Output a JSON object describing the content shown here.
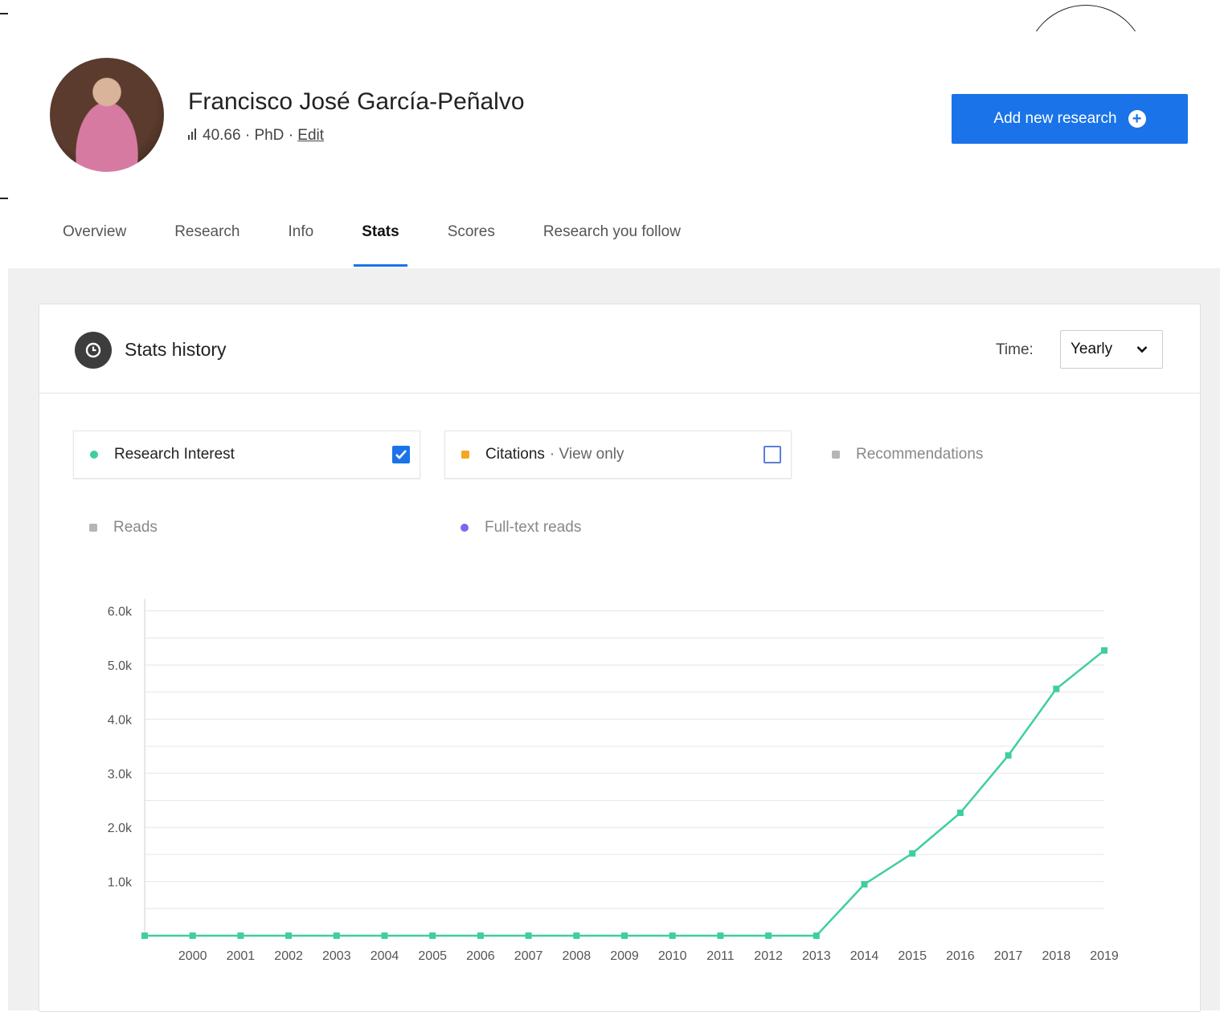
{
  "profile": {
    "name": "Francisco José García-Peñalvo",
    "score": "40.66",
    "degree": "PhD",
    "edit_label": "Edit",
    "separator": "·"
  },
  "actions": {
    "add_research_label": "Add new research"
  },
  "tabs": [
    {
      "label": "Overview"
    },
    {
      "label": "Research"
    },
    {
      "label": "Info"
    },
    {
      "label": "Stats",
      "active": true
    },
    {
      "label": "Scores"
    },
    {
      "label": "Research you follow"
    }
  ],
  "stats": {
    "title": "Stats history",
    "time_label": "Time:",
    "time_value": "Yearly",
    "metrics": [
      {
        "label": "Research Interest",
        "color": "#3ecf9e",
        "checked": true
      },
      {
        "label": "Citations",
        "sub": "· View only",
        "color": "#f5a623",
        "checked": false
      },
      {
        "label": "Recommendations",
        "color": "#9e9e9e"
      },
      {
        "label": "Reads",
        "color": "#9e9e9e"
      },
      {
        "label": "Full-text reads",
        "color": "#7b68ee"
      }
    ]
  },
  "chart_data": {
    "type": "line",
    "x": [
      "1999",
      "2000",
      "2001",
      "2002",
      "2003",
      "2004",
      "2005",
      "2006",
      "2007",
      "2008",
      "2009",
      "2010",
      "2011",
      "2012",
      "2013",
      "2014",
      "2015",
      "2016",
      "2017",
      "2018",
      "2019"
    ],
    "x_tick_labels": [
      "2000",
      "2001",
      "2002",
      "2003",
      "2004",
      "2005",
      "2006",
      "2007",
      "2008",
      "2009",
      "2010",
      "2011",
      "2012",
      "2013",
      "2014",
      "2015",
      "2016",
      "2017",
      "2018",
      "2019"
    ],
    "series": [
      {
        "name": "Research Interest",
        "color": "#3ecf9e",
        "values": [
          0,
          0,
          0,
          0,
          0,
          0,
          0,
          0,
          0,
          0,
          0,
          0,
          0,
          0,
          0,
          950,
          1520,
          2270,
          3330,
          4560,
          5270
        ]
      }
    ],
    "y_ticks": [
      "1.0k",
      "2.0k",
      "3.0k",
      "4.0k",
      "5.0k",
      "6.0k"
    ],
    "y_tick_values": [
      1000,
      2000,
      3000,
      4000,
      5000,
      6000
    ],
    "ylim": [
      0,
      6000
    ],
    "grid": true
  }
}
